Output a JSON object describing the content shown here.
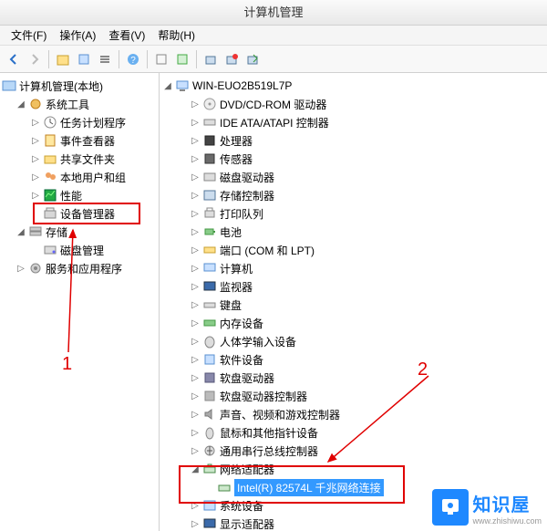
{
  "window": {
    "title": "计算机管理"
  },
  "menu": {
    "file": "文件(F)",
    "action": "操作(A)",
    "view": "查看(V)",
    "help": "帮助(H)"
  },
  "left": {
    "root": "计算机管理(本地)",
    "systools": "系统工具",
    "task": "任务计划程序",
    "event": "事件查看器",
    "share": "共享文件夹",
    "users": "本地用户和组",
    "perf": "性能",
    "devmgr": "设备管理器",
    "storage": "存储",
    "disk": "磁盘管理",
    "services": "服务和应用程序"
  },
  "right": {
    "root": "WIN-EUO2B519L7P",
    "items": [
      {
        "k": "dvd",
        "t": "DVD/CD-ROM 驱动器"
      },
      {
        "k": "ide",
        "t": "IDE ATA/ATAPI 控制器"
      },
      {
        "k": "cpu",
        "t": "处理器"
      },
      {
        "k": "sensor",
        "t": "传感器"
      },
      {
        "k": "diskdrive",
        "t": "磁盘驱动器"
      },
      {
        "k": "storagectl",
        "t": "存储控制器"
      },
      {
        "k": "printq",
        "t": "打印队列"
      },
      {
        "k": "battery",
        "t": "电池"
      },
      {
        "k": "ports",
        "t": "端口 (COM 和 LPT)"
      },
      {
        "k": "computer",
        "t": "计算机"
      },
      {
        "k": "monitor",
        "t": "监视器"
      },
      {
        "k": "keyboard",
        "t": "键盘"
      },
      {
        "k": "memory",
        "t": "内存设备"
      },
      {
        "k": "hid",
        "t": "人体学输入设备"
      },
      {
        "k": "software",
        "t": "软件设备"
      },
      {
        "k": "floppy",
        "t": "软盘驱动器"
      },
      {
        "k": "floppyctl",
        "t": "软盘驱动器控制器"
      },
      {
        "k": "sound",
        "t": "声音、视频和游戏控制器"
      },
      {
        "k": "mouse",
        "t": "鼠标和其他指针设备"
      },
      {
        "k": "usb",
        "t": "通用串行总线控制器"
      },
      {
        "k": "netadapter",
        "t": "网络适配器"
      }
    ],
    "nic": "Intel(R) 82574L 千兆网络连接",
    "after": [
      {
        "k": "sysdev",
        "t": "系统设备"
      },
      {
        "k": "display",
        "t": "显示适配器"
      }
    ]
  },
  "annot": {
    "n1": "1",
    "n2": "2"
  },
  "watermark": {
    "cn": "知识屋",
    "en": "www.zhishiwu.com"
  }
}
